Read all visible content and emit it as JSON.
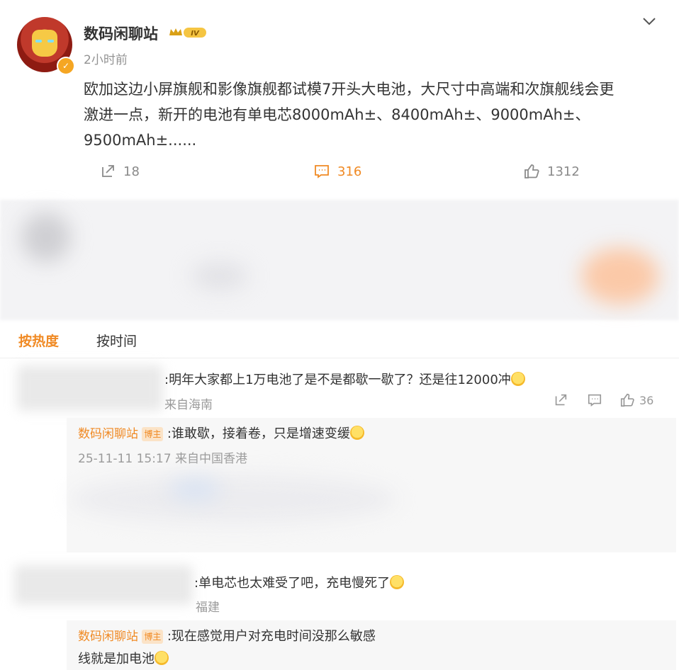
{
  "post": {
    "author": "数码闲聊站",
    "level_badge": "IV",
    "time": "2小时前",
    "text_line1": "欧加这边小屏旗舰和影像旗舰都试模7开头大电池，大尺寸中高端和次旗舰线会更",
    "text_line2": "激进一点，新开的电池有单电芯8000mAh±、8400mAh±、9000mAh±、",
    "text_line3": "9500mAh±......",
    "repost_count": "18",
    "comment_count": "316",
    "like_count": "1312",
    "accent_color": "#f08a24"
  },
  "sort": {
    "by_hot": "按热度",
    "by_time": "按时间"
  },
  "comments": [
    {
      "text": ":明年大家都上1万电池了是不是都歇一歇了？还是往12000冲",
      "meta": "来自海南",
      "like_count": "36",
      "reply": {
        "author": "数码闲聊站",
        "tag": "博主",
        "text": ":谁敢歇，接着卷，只是增速变缓",
        "meta": "25-11-11 15:17 来自中国香港"
      }
    },
    {
      "text": ":单电芯也太难受了吧，充电慢死了",
      "meta": "福建",
      "reply": {
        "author": "数码闲聊站",
        "tag": "博主",
        "text": ":现在感觉用户对充电时间没那么敏感",
        "text2": "线就是加电池"
      }
    }
  ]
}
